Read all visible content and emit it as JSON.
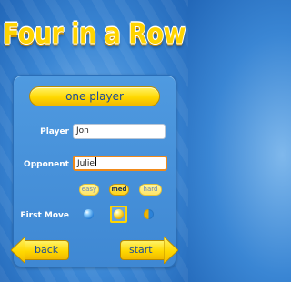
{
  "title": "Four in a Row",
  "mode_button": "one player",
  "player": {
    "label": "Player",
    "value": "Jon"
  },
  "opponent": {
    "label": "Opponent",
    "value": "Julie"
  },
  "difficulty": {
    "options": [
      "easy",
      "med",
      "hard"
    ],
    "selected": "med"
  },
  "first_move": {
    "label": "First Move",
    "options": [
      "blue-ball-icon",
      "yellow-ball-icon",
      "random-ball-icon"
    ],
    "selected": "yellow-ball-icon"
  },
  "nav": {
    "back": "back",
    "start": "start"
  },
  "colors": {
    "accent_yellow": "#ffd800",
    "background_blue": "#3a86d4",
    "text_blue": "#1a4a9a",
    "focus_orange": "#f08a1a"
  }
}
